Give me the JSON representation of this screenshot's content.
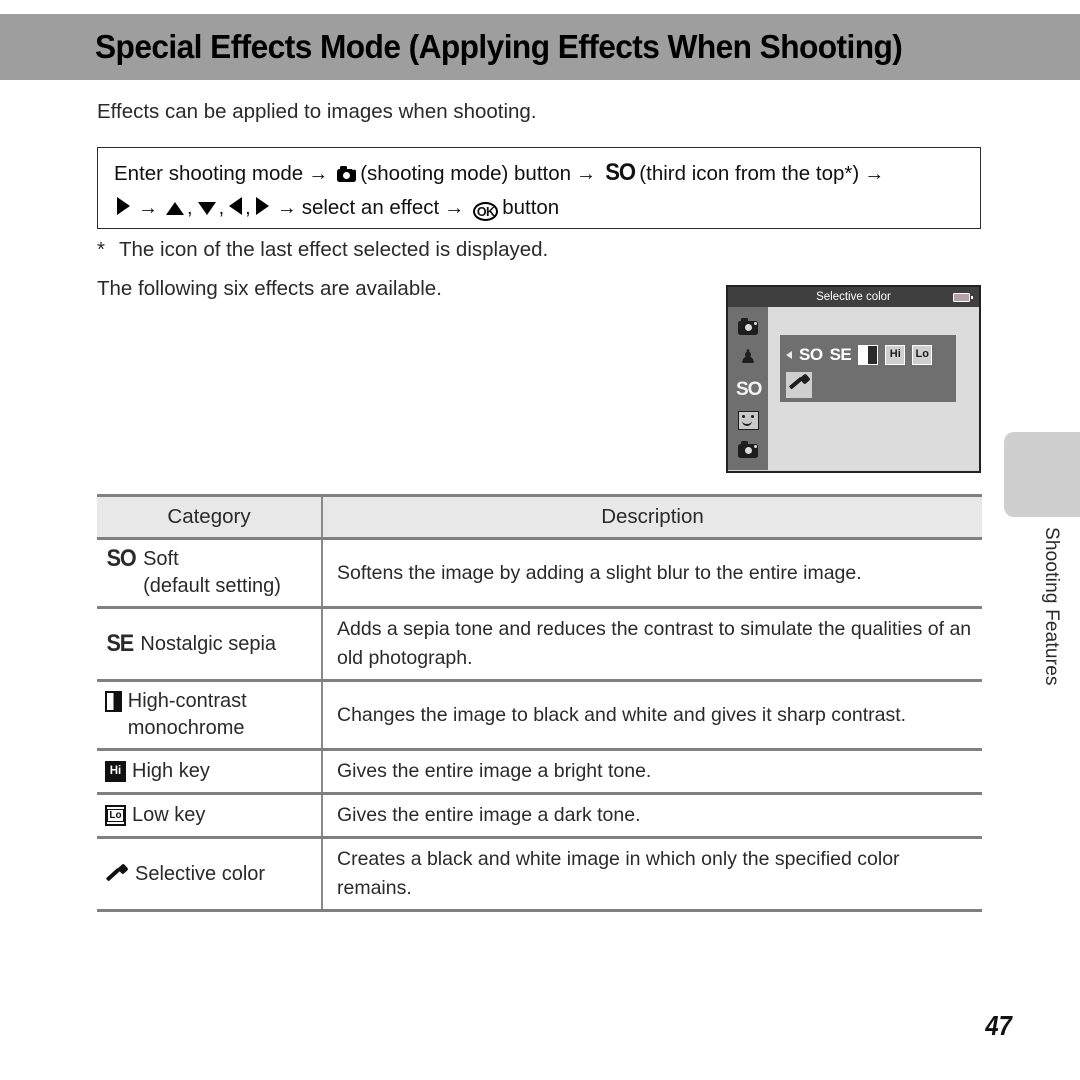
{
  "page": {
    "title": "Special Effects Mode (Applying Effects When Shooting)",
    "intro": "Effects can be applied to images when shooting.",
    "footnote_star": "*",
    "footnote": "The icon of the last effect selected is displayed.",
    "lead_in": "The following six effects are available.",
    "page_number": "47",
    "side_tab_label": "Shooting Features",
    "title_bar_color": "#9e9e9e",
    "table_rule_color": "#808080",
    "header_fill_color": "#e8e8e8"
  },
  "procedure": {
    "line1": {
      "t1": "Enter shooting mode",
      "cam_icon": "camera-icon",
      "t2": "(shooting mode) button",
      "so_icon": "SO",
      "t3": "(third icon from the top*)"
    },
    "line2": {
      "right_icon": "triangle-right-icon",
      "up_icon": "triangle-up-icon",
      "down_icon": "triangle-down-icon",
      "left_icon": "triangle-left-icon",
      "right_icon2": "triangle-right-icon",
      "comma": ",",
      "t1": "select an effect",
      "ok_label": "OK",
      "t2": "button"
    },
    "arrow": "→"
  },
  "lcd": {
    "title": "Selective color",
    "battery": "battery-icon",
    "sidebar": [
      {
        "icon": "camera-auto-icon",
        "selected": false
      },
      {
        "icon": "scene-mode-icon",
        "glyph": "♟",
        "selected": false
      },
      {
        "icon": "special-effects-icon",
        "glyph": "SO",
        "selected": true
      },
      {
        "icon": "smart-portrait-icon",
        "selected": false
      },
      {
        "icon": "camera-mode-icon",
        "selected": false
      }
    ],
    "effects": [
      {
        "glyph": "SO",
        "type": "text",
        "name": "soft"
      },
      {
        "glyph": "SE",
        "type": "text",
        "name": "nostalgic-sepia"
      },
      {
        "glyph": "",
        "type": "half",
        "name": "high-contrast-monochrome"
      },
      {
        "glyph": "Hi",
        "type": "box",
        "name": "high-key"
      },
      {
        "glyph": "Lo",
        "type": "box",
        "name": "low-key"
      },
      {
        "glyph": "",
        "type": "dropper",
        "name": "selective-color"
      }
    ]
  },
  "table": {
    "headers": {
      "category": "Category",
      "description": "Description"
    },
    "rows": [
      {
        "icon": "SO",
        "icon_type": "so",
        "name": "Soft",
        "sub": "(default setting)",
        "description": "Softens the image by adding a slight blur to the entire image."
      },
      {
        "icon": "SE",
        "icon_type": "so",
        "name": "Nostalgic sepia",
        "sub": "",
        "description": "Adds a sepia tone and reduces the contrast to simulate the qualities of an old photograph."
      },
      {
        "icon": "",
        "icon_type": "half",
        "name": "High-contrast monochrome",
        "sub": "",
        "description": "Changes the image to black and white and gives it sharp contrast."
      },
      {
        "icon": "Hi",
        "icon_type": "box",
        "name": "High key",
        "sub": "",
        "description": "Gives the entire image a bright tone."
      },
      {
        "icon": "Lo",
        "icon_type": "boxinv",
        "name": "Low key",
        "sub": "",
        "description": "Gives the entire image a dark tone."
      },
      {
        "icon": "",
        "icon_type": "dropper",
        "name": "Selective color",
        "sub": "",
        "description": "Creates a black and white image in which only the specified color remains."
      }
    ]
  }
}
